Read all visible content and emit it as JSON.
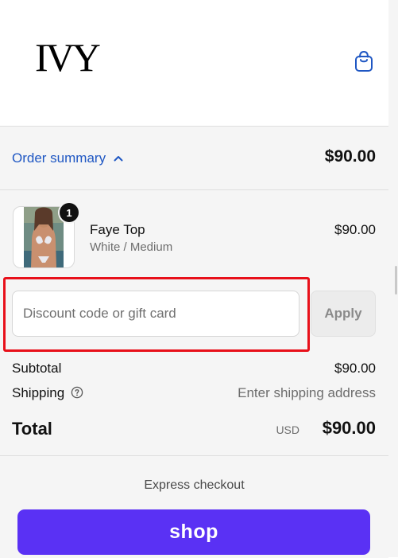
{
  "header": {
    "logo_text": "IVY",
    "cart_icon": "shopping-bag-icon"
  },
  "summary": {
    "toggle_label": "Order summary",
    "toggle_icon": "chevron-up-icon",
    "total": "$90.00"
  },
  "item": {
    "quantity": "1",
    "name": "Faye Top",
    "variant": "White / Medium",
    "price": "$90.00",
    "image": "product-photo"
  },
  "discount": {
    "placeholder": "Discount code or gift card",
    "value": "",
    "apply_label": "Apply"
  },
  "totals": {
    "subtotal_label": "Subtotal",
    "subtotal_value": "$90.00",
    "shipping_label": "Shipping",
    "shipping_icon": "help-circle-icon",
    "shipping_value": "Enter shipping address",
    "total_label": "Total",
    "currency": "USD",
    "total_value": "$90.00"
  },
  "express": {
    "label": "Express checkout",
    "shop_label": "shop"
  },
  "colors": {
    "link": "#1f57c3",
    "shop_pay": "#5a31f4",
    "highlight": "#e8101a",
    "panel_bg": "#f5f5f5"
  }
}
